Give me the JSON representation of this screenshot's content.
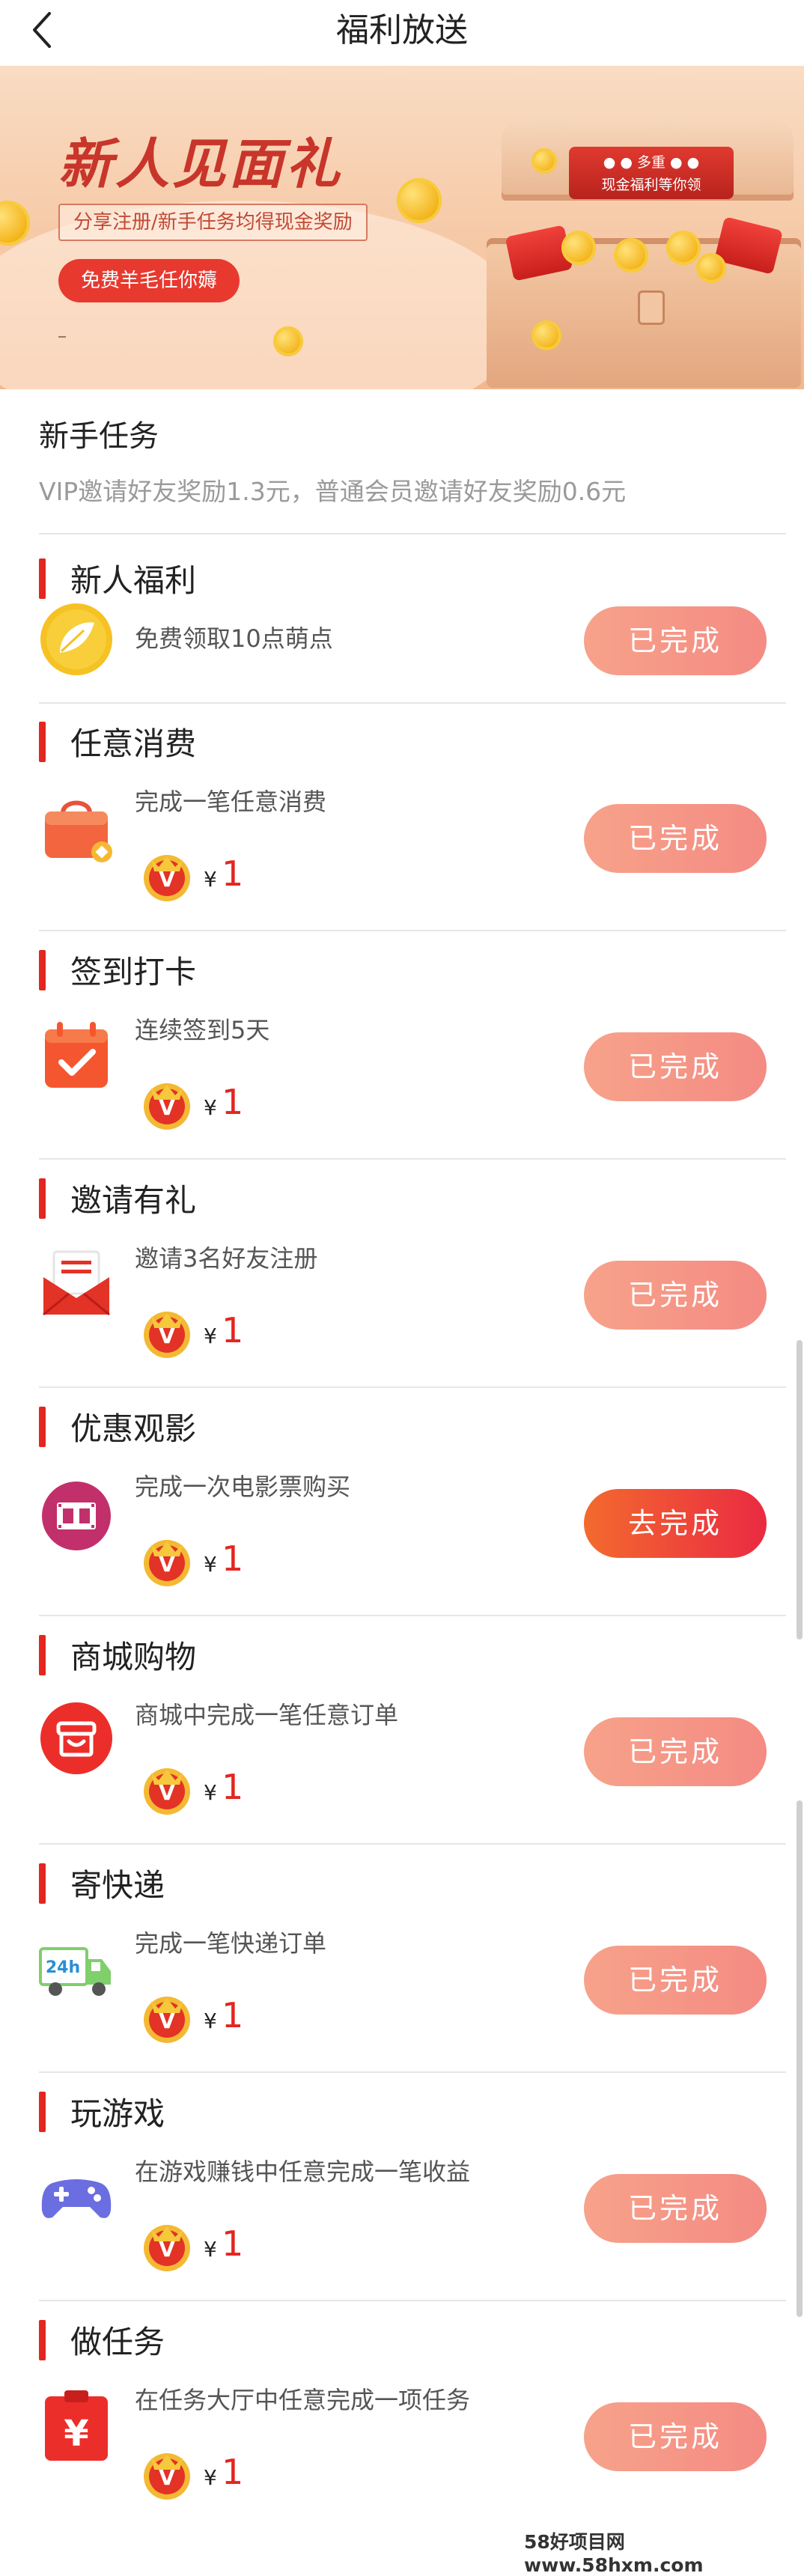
{
  "header": {
    "title": "福利放送"
  },
  "banner": {
    "title": "新人见面礼",
    "subtitle": "分享注册/新手任务均得现金奖励",
    "button_label": "免费羊毛任你薅",
    "chest_line1": "● ● 多重 ● ●",
    "chest_line2": "现金福利等你领"
  },
  "section": {
    "title": "新手任务",
    "description": "VIP邀请好友奖励1.3元，普通会员邀请好友奖励0.6元"
  },
  "tasks": [
    {
      "title": "新人福利",
      "desc": "免费领取10点萌点",
      "icon": "leaf-coin-icon",
      "button": "已完成",
      "status": "done"
    },
    {
      "title": "任意消费",
      "desc": "完成一笔任意消费",
      "icon": "shopping-bag-icon",
      "yen": "¥",
      "reward": "1",
      "button": "已完成",
      "status": "done"
    },
    {
      "title": "签到打卡",
      "desc": "连续签到5天",
      "icon": "calendar-check-icon",
      "yen": "¥",
      "reward": "1",
      "button": "已完成",
      "status": "done"
    },
    {
      "title": "邀请有礼",
      "desc": "邀请3名好友注册",
      "icon": "envelope-icon",
      "yen": "¥",
      "reward": "1",
      "button": "已完成",
      "status": "done"
    },
    {
      "title": "优惠观影",
      "desc": "完成一次电影票购买",
      "icon": "film-icon",
      "yen": "¥",
      "reward": "1",
      "button": "去完成",
      "status": "todo"
    },
    {
      "title": "商城购物",
      "desc": "商城中完成一笔任意订单",
      "icon": "store-icon",
      "yen": "¥",
      "reward": "1",
      "button": "已完成",
      "status": "done"
    },
    {
      "title": "寄快递",
      "desc": "完成一笔快递订单",
      "icon": "delivery-truck-icon",
      "yen": "¥",
      "reward": "1",
      "button": "已完成",
      "status": "done"
    },
    {
      "title": "玩游戏",
      "desc": "在游戏赚钱中任意完成一笔收益",
      "icon": "gamepad-icon",
      "yen": "¥",
      "reward": "1",
      "button": "已完成",
      "status": "done"
    },
    {
      "title": "做任务",
      "desc": "在任务大厅中任意完成一项任务",
      "icon": "task-money-icon",
      "yen": "¥",
      "reward": "1",
      "button": "已完成",
      "status": "done"
    }
  ],
  "colors": {
    "accent": "#e3261f",
    "done_button": "#f48b83",
    "go_button": "#ea2a42"
  },
  "footer": {
    "watermark": "58好项目网www.58hxm.com"
  }
}
